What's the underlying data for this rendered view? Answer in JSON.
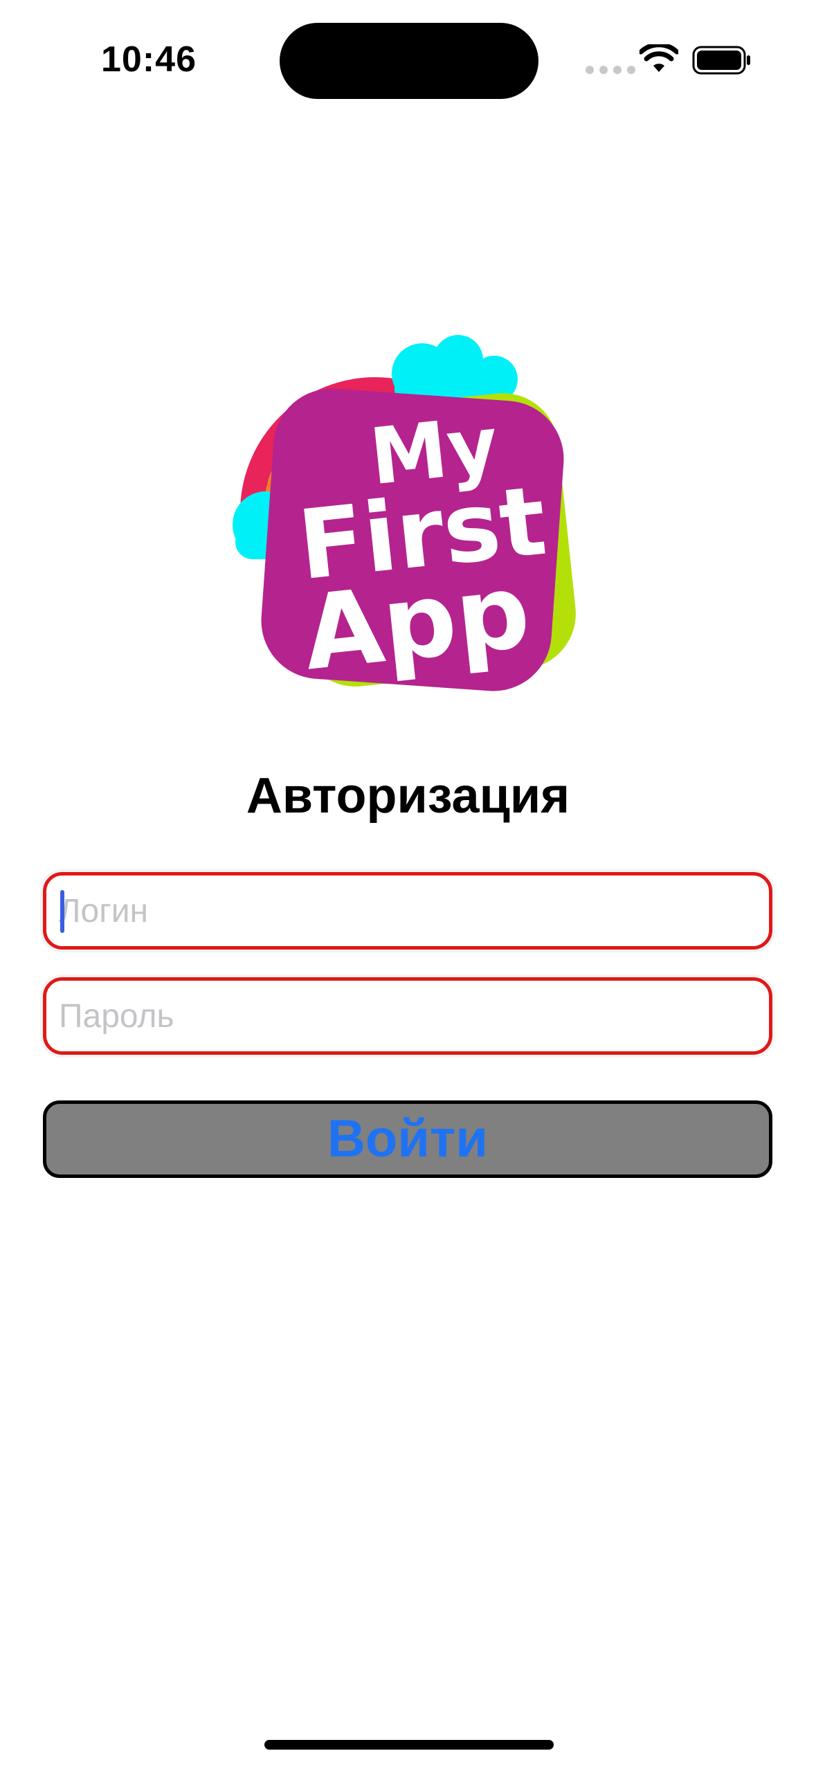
{
  "status_bar": {
    "time": "10:46",
    "icons": [
      "cellular-signal-icon",
      "wifi-icon",
      "battery-icon"
    ]
  },
  "logo": {
    "line1": "My",
    "line2": "First",
    "line3": "App"
  },
  "title": "Авторизация",
  "form": {
    "login_placeholder": "Логин",
    "login_value": "",
    "password_placeholder": "Пароль",
    "password_value": "",
    "submit_label": "Войти"
  },
  "colors": {
    "field_border": "#e11818",
    "button_background": "#808080",
    "button_text": "#1f73f2",
    "logo_tile": "#b5238f",
    "logo_back_tile": "#b4e00a",
    "cloud": "#00f0f8"
  }
}
